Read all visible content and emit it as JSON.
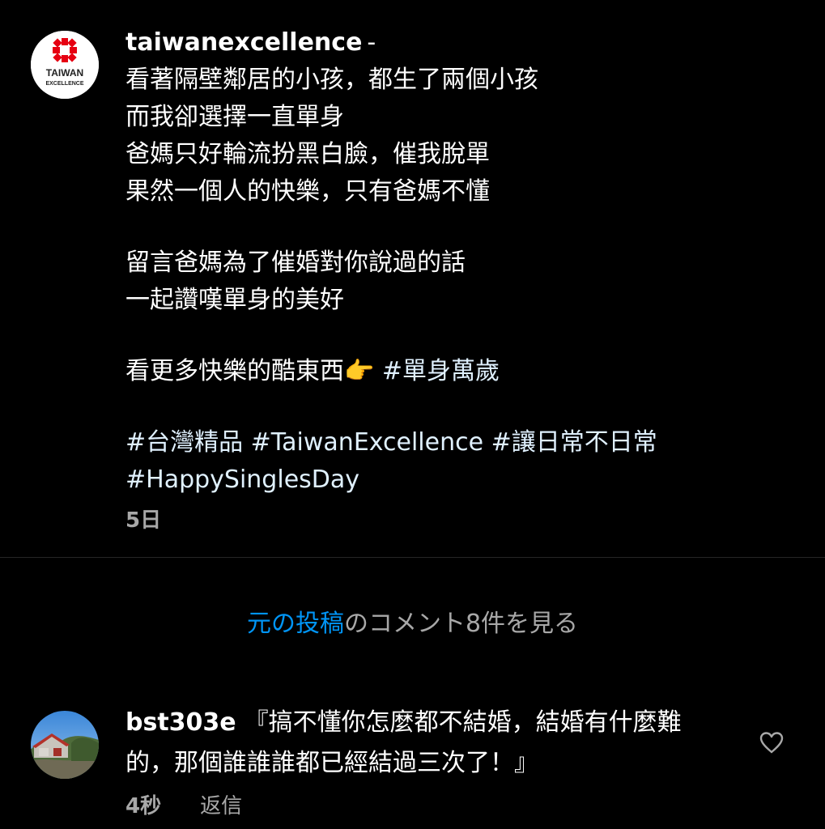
{
  "post": {
    "username": "taiwanexcellence",
    "separator": "-",
    "avatar_logo_text_1": "TAIWAN",
    "avatar_logo_text_2": "EXCELLENCE",
    "caption_lines": [
      "看著隔壁鄰居的小孩，都生了兩個小孩",
      "而我卻選擇一直單身",
      "爸媽只好輪流扮黑白臉，催我脫單",
      "果然一個人的快樂，只有爸媽不懂",
      "留言爸媽為了催婚對你說過的話",
      "一起讚嘆單身的美好",
      "看更多快樂的酷東西"
    ],
    "emoji_pointing": "👉",
    "hashtag_single": "#單身萬歲",
    "hashtags_line1": "#台灣精品 #TaiwanExcellence #讓日常不日常",
    "hashtags_line2": "#HappySinglesDay",
    "time": "5日"
  },
  "view_comments": {
    "link_text": "元の投稿",
    "rest_text": "のコメント8件を見る"
  },
  "comment": {
    "username": "bst303e",
    "text": "『搞不懂你怎麼都不結婚，結婚有什麼難的，那個誰誰誰都已經結過三次了！』",
    "time": "4秒",
    "reply_label": "返信"
  },
  "icons": {
    "avatar_logo": "taiwan-excellence-logo-icon",
    "like": "heart-icon"
  },
  "colors": {
    "background": "#000000",
    "link": "#0095f6",
    "secondary_text": "#a8a8a8",
    "logo_red": "#e60012"
  }
}
